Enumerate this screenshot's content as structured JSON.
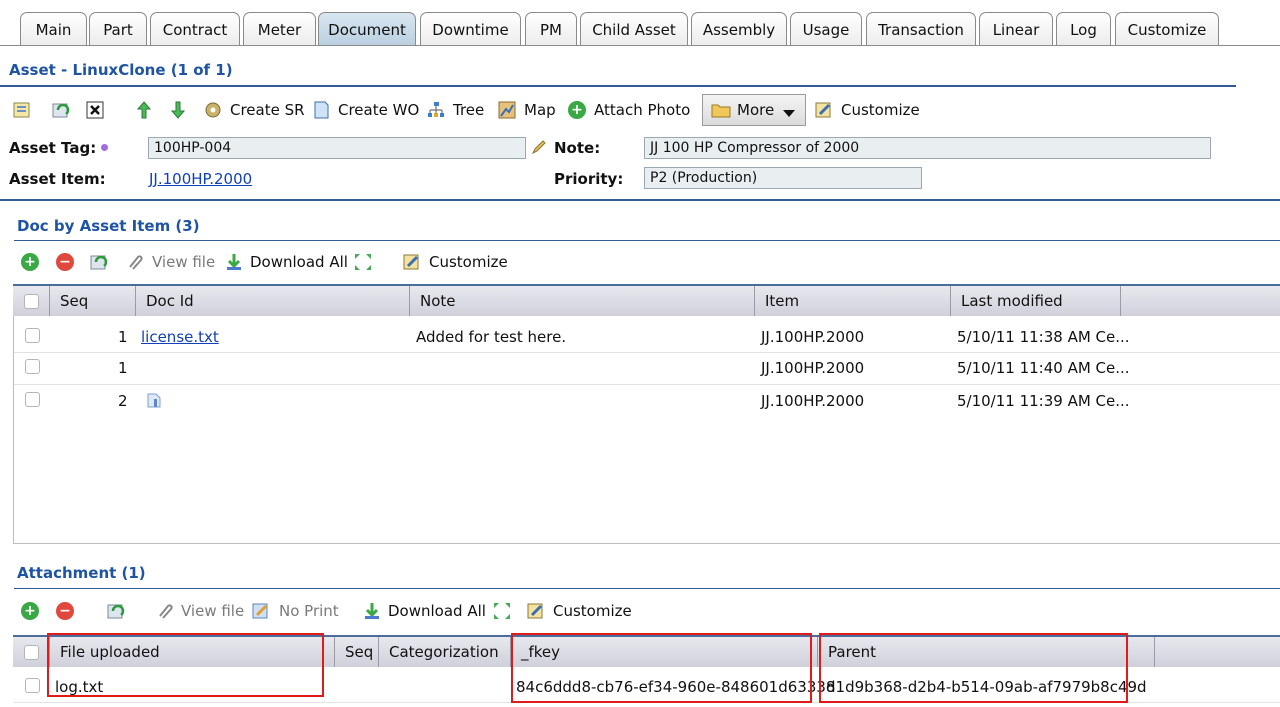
{
  "tabs": [
    "Main",
    "Part",
    "Contract",
    "Meter",
    "Document",
    "Downtime",
    "PM",
    "Child Asset",
    "Assembly",
    "Usage",
    "Transaction",
    "Linear",
    "Log",
    "Customize"
  ],
  "active_tab": "Document",
  "asset": {
    "title": "Asset - LinuxClone (1 of 1)",
    "toolbar": {
      "create_sr": "Create SR",
      "create_wo": "Create WO",
      "tree": "Tree",
      "map": "Map",
      "attach_photo": "Attach Photo",
      "more": "More",
      "customize": "Customize"
    },
    "tag_label": "Asset Tag:",
    "tag_value": "100HP-004",
    "item_label": "Asset Item:",
    "item_value": "JJ.100HP.2000",
    "note_label": "Note:",
    "note_value": "JJ 100 HP Compressor of 2000",
    "priority_label": "Priority:",
    "priority_value": "P2 (Production)"
  },
  "doc": {
    "title": "Doc by Asset Item (3)",
    "toolbar": {
      "view_file": "View file",
      "download_all": "Download All",
      "customize": "Customize"
    },
    "columns": [
      "Seq",
      "Doc Id",
      "Note",
      "Item",
      "Last modified"
    ],
    "rows": [
      {
        "seq": "1",
        "doc_id": "license.txt",
        "note": "Added for test here.",
        "item": "JJ.100HP.2000",
        "modified": "5/10/11 11:38 AM Ce..."
      },
      {
        "seq": "1",
        "doc_id": "",
        "note": "",
        "item": "JJ.100HP.2000",
        "modified": "5/10/11 11:40 AM Ce..."
      },
      {
        "seq": "2",
        "doc_id": "",
        "note": "",
        "item": "JJ.100HP.2000",
        "modified": "5/10/11 11:39 AM Ce..."
      }
    ]
  },
  "attachment": {
    "title": "Attachment (1)",
    "toolbar": {
      "view_file": "View file",
      "no_print": "No Print",
      "download_all": "Download All",
      "customize": "Customize"
    },
    "columns": [
      "File uploaded",
      "Seq",
      "Categorization",
      "_fkey",
      "Parent"
    ],
    "rows": [
      {
        "file": "log.txt",
        "seq": "",
        "categorization": "",
        "fkey": "84c6ddd8-cb76-ef34-960e-848601d63338",
        "parent": "d1d9b368-d2b4-b514-09ab-af7979b8c49d"
      }
    ]
  },
  "colors": {
    "title_blue": "#1f54a3",
    "link_blue": "#1140b8",
    "header_border": "#2f5c98",
    "highlight_red": "#e01b1b",
    "add_green": "#3aa845",
    "remove_red": "#e0483e"
  }
}
